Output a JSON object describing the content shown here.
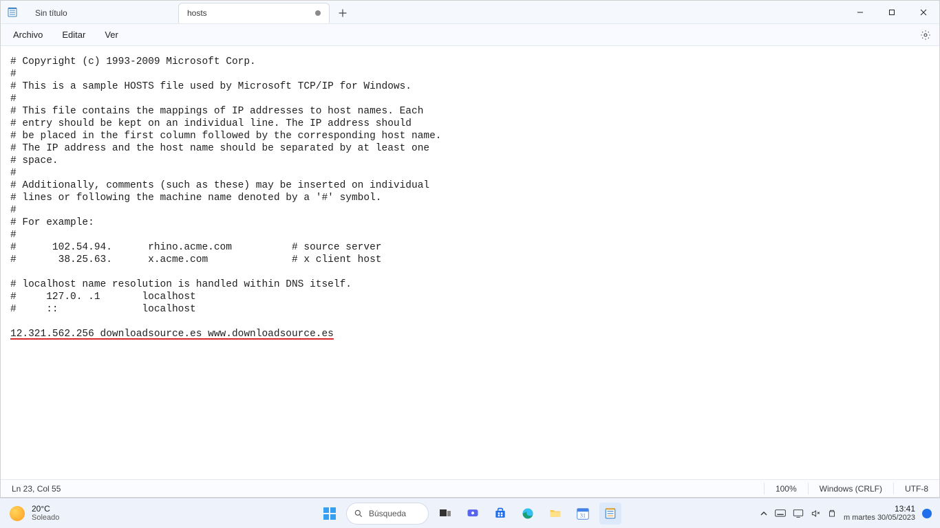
{
  "titlebar": {
    "tabs": [
      {
        "title": "Sin título",
        "active": false,
        "dirty": false
      },
      {
        "title": "hosts",
        "active": true,
        "dirty": true
      }
    ],
    "newtab_tooltip": "+"
  },
  "menu": {
    "file": "Archivo",
    "edit": "Editar",
    "view": "Ver"
  },
  "editor": {
    "lines": [
      "# Copyright (c) 1993-2009 Microsoft Corp.",
      "#",
      "# This is a sample HOSTS file used by Microsoft TCP/IP for Windows.",
      "#",
      "# This file contains the mappings of IP addresses to host names. Each",
      "# entry should be kept on an individual line. The IP address should",
      "# be placed in the first column followed by the corresponding host name.",
      "# The IP address and the host name should be separated by at least one",
      "# space.",
      "#",
      "# Additionally, comments (such as these) may be inserted on individual",
      "# lines or following the machine name denoted by a '#' symbol.",
      "#",
      "# For example:",
      "#",
      "#      102.54.94.      rhino.acme.com          # source server",
      "#       38.25.63.      x.acme.com              # x client host",
      "",
      "# localhost name resolution is handled within DNS itself.",
      "#     127.0. .1       localhost",
      "#     ::              localhost"
    ],
    "highlighted_line": "12.321.562.256 downloadsource.es www.downloadsource.es"
  },
  "statusbar": {
    "position": "Ln 23, Col 55",
    "zoom": "100%",
    "eol": "Windows (CRLF)",
    "encoding": "UTF-8"
  },
  "taskbar": {
    "weather_temp": "20°C",
    "weather_desc": "Soleado",
    "search_placeholder": "Búsqueda",
    "clock_time": "13:41",
    "clock_date_prefix": "m  martes ",
    "clock_date": "30/05/2023",
    "calendar_day": "31"
  }
}
